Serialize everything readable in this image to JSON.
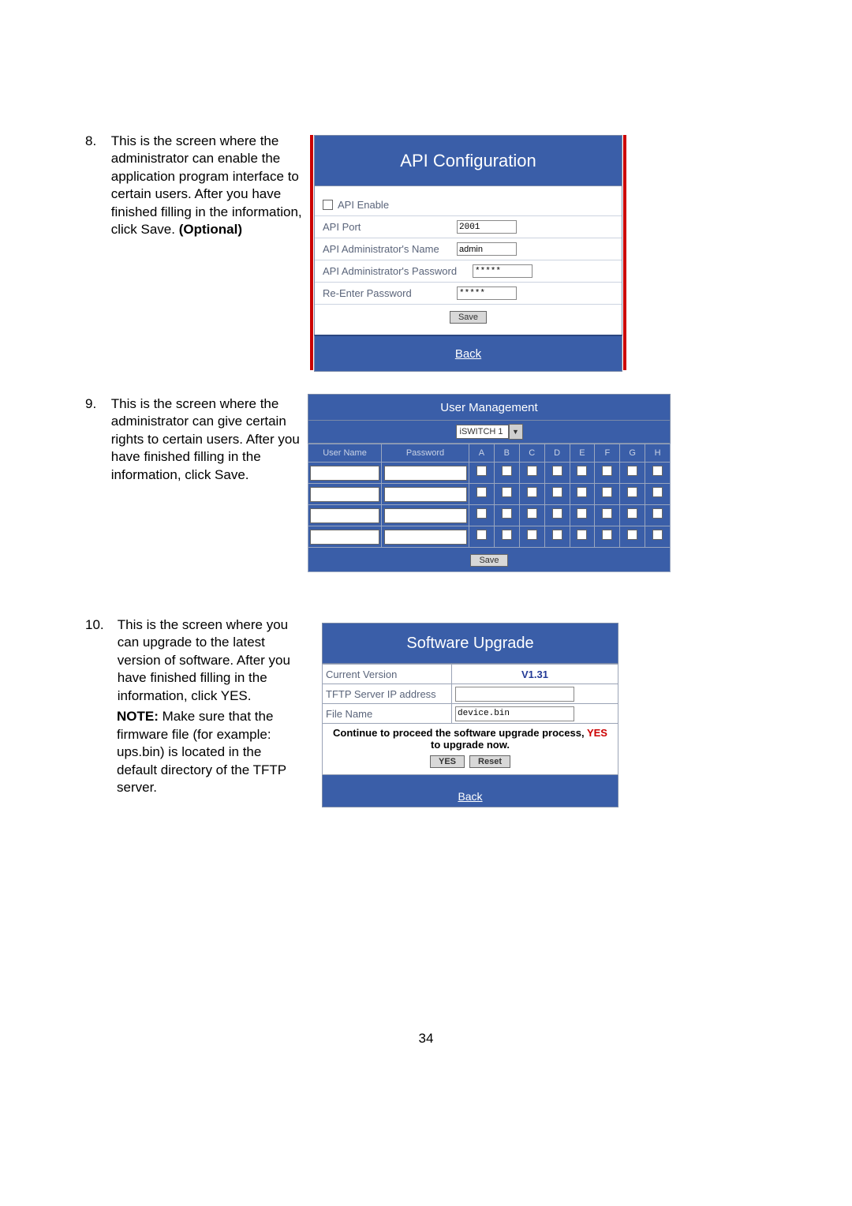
{
  "page_number": "34",
  "instr8": {
    "num": "8.",
    "text_a": "This is the screen where the administrator can enable the application program interface to certain users.  After you have finished filling in the information, click Save. ",
    "optional": "(Optional)"
  },
  "instr9": {
    "num": "9.",
    "text": "This is the screen where the administrator can give certain rights to certain users.  After you have finished filling in the information, click Save."
  },
  "instr10": {
    "num": "10.",
    "text": "This is the screen where you can upgrade to the latest version of software.  After you have finished filling in the information, click YES.",
    "note_label": "NOTE:",
    "note_text": "  Make sure that the firmware file (for example: ups.bin) is located in the default directory of the TFTP server."
  },
  "panel1": {
    "title": "API Configuration",
    "enable_label": "API Enable",
    "port_label": "API Port",
    "port_value": "2001",
    "admin_name_label": "API Administrator's Name",
    "admin_name_value": "admin",
    "admin_pw_label": "API Administrator's Password",
    "admin_pw_value": "*****",
    "reenter_label": "Re-Enter Password",
    "reenter_value": "*****",
    "save": "Save",
    "back": "Back"
  },
  "panel2": {
    "title": "User Management",
    "select_value": "iSWITCH 1",
    "cols": {
      "user": "User Name",
      "pw": "Password",
      "A": "A",
      "B": "B",
      "C": "C",
      "D": "D",
      "E": "E",
      "F": "F",
      "G": "G",
      "H": "H"
    },
    "save": "Save"
  },
  "panel3": {
    "title": "Software Upgrade",
    "curver_label": "Current Version",
    "curver_value": "V1.31",
    "tftp_label": "TFTP Server IP address",
    "tftp_value": "",
    "file_label": "File Name",
    "file_value": "device.bin",
    "msg_a": "Continue to proceed the software upgrade process, ",
    "msg_yes": "YES",
    "msg_b": " to upgrade now.",
    "yes": "YES",
    "reset": "Reset",
    "back": "Back"
  }
}
